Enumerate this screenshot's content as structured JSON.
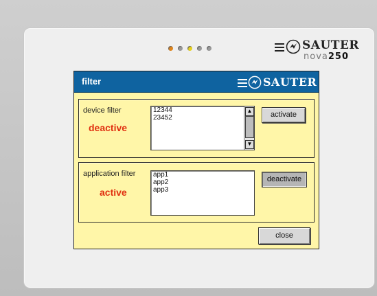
{
  "brand": {
    "name": "SAUTER",
    "model_prefix": "nova",
    "model_number": "250"
  },
  "leds": [
    "orange",
    "gray",
    "yellow",
    "gray",
    "gray"
  ],
  "dialog": {
    "title": "filter",
    "title_brand": "SAUTER",
    "device_filter": {
      "label": "device filter",
      "status": "deactive",
      "items": [
        "12344",
        "23452"
      ],
      "button": "activate"
    },
    "application_filter": {
      "label": "application filter",
      "status": "active",
      "items": [
        "app1",
        "app2",
        "app3"
      ],
      "button": "deactivate"
    },
    "close_button": "close"
  },
  "colors": {
    "titlebar": "#0f63a0",
    "dialog_bg": "#fff6a8",
    "status_text": "#e03010"
  }
}
